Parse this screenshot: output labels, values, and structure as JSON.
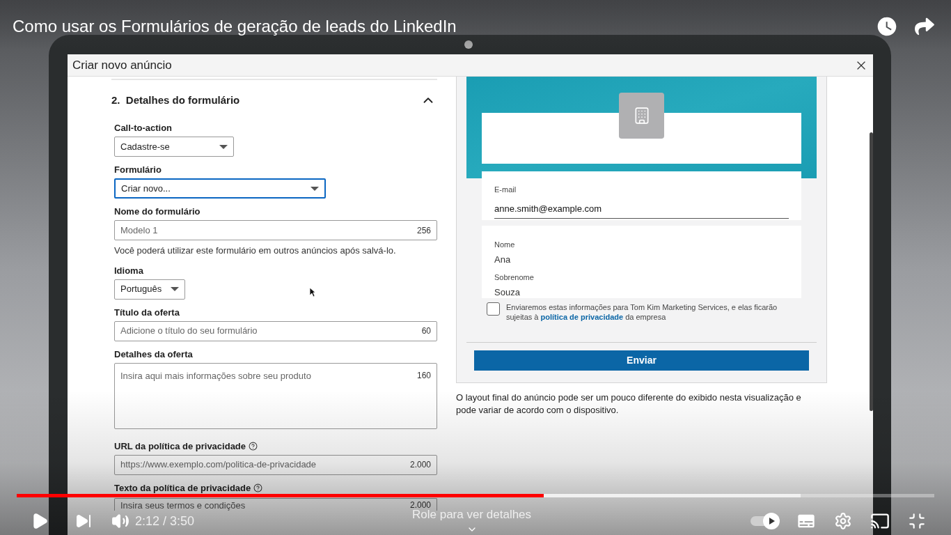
{
  "video": {
    "title": "Como usar os Formulários de geração de leads do LinkedIn"
  },
  "app_window": {
    "title": "Criar novo anúncio",
    "section": {
      "number": "2.",
      "title": "Detalhes do formulário",
      "expanded": true
    },
    "fields": [
      {
        "kind": "select",
        "label": "Call-to-action",
        "value": "Cadastre-se",
        "focused": false
      },
      {
        "kind": "select",
        "label": "Formulário",
        "value": "Criar novo...",
        "focused": true
      },
      {
        "kind": "input",
        "label": "Nome do formulário",
        "placeholder": "Modelo 1",
        "counter": "256",
        "help": "Você poderá utilizar este formulário em outros anúncios após salvá-lo."
      },
      {
        "kind": "select",
        "label": "Idioma",
        "value": "Português",
        "focused": false
      },
      {
        "kind": "input",
        "label": "Título da oferta",
        "placeholder": "Adicione o título do seu formulário",
        "counter": "60"
      },
      {
        "kind": "textarea",
        "label": "Detalhes da oferta",
        "placeholder": "Insira aqui mais informações sobre seu produto",
        "counter": "160"
      },
      {
        "kind": "input",
        "label": "URL da política de privacidade",
        "info": true,
        "placeholder": "https://www.exemplo.com/politica-de-privacidade",
        "counter": "2.000"
      },
      {
        "kind": "textarea",
        "label": "Texto da política de privacidade",
        "info": true,
        "placeholder": "Insira seus termos e condições",
        "counter": "2.000"
      }
    ],
    "preview": {
      "email": {
        "label": "E-mail",
        "value": "anne.smith@example.com"
      },
      "name_fields": [
        {
          "label": "Nome",
          "value": "Ana"
        },
        {
          "label": "Sobrenome",
          "value": "Souza"
        }
      ],
      "consent": {
        "checked": false,
        "text": "Enviaremos estas informações para Tom Kim Marketing Services, e elas ficarão sujeitas à ",
        "link": "política de privacidade",
        "after": " da empresa"
      },
      "submit": "Enviar"
    },
    "note": "O layout final do anúncio pode ser um pouco diferente do exibido nesta visualização e pode variar de acordo com o dispositivo."
  },
  "player": {
    "played": {
      "level": 0.574
    },
    "buffered": {
      "level": 0.854
    },
    "time": "2:12 / 3:50",
    "scroll_hint": "Role para ver detalhes",
    "autoplay": {
      "on": true
    }
  }
}
